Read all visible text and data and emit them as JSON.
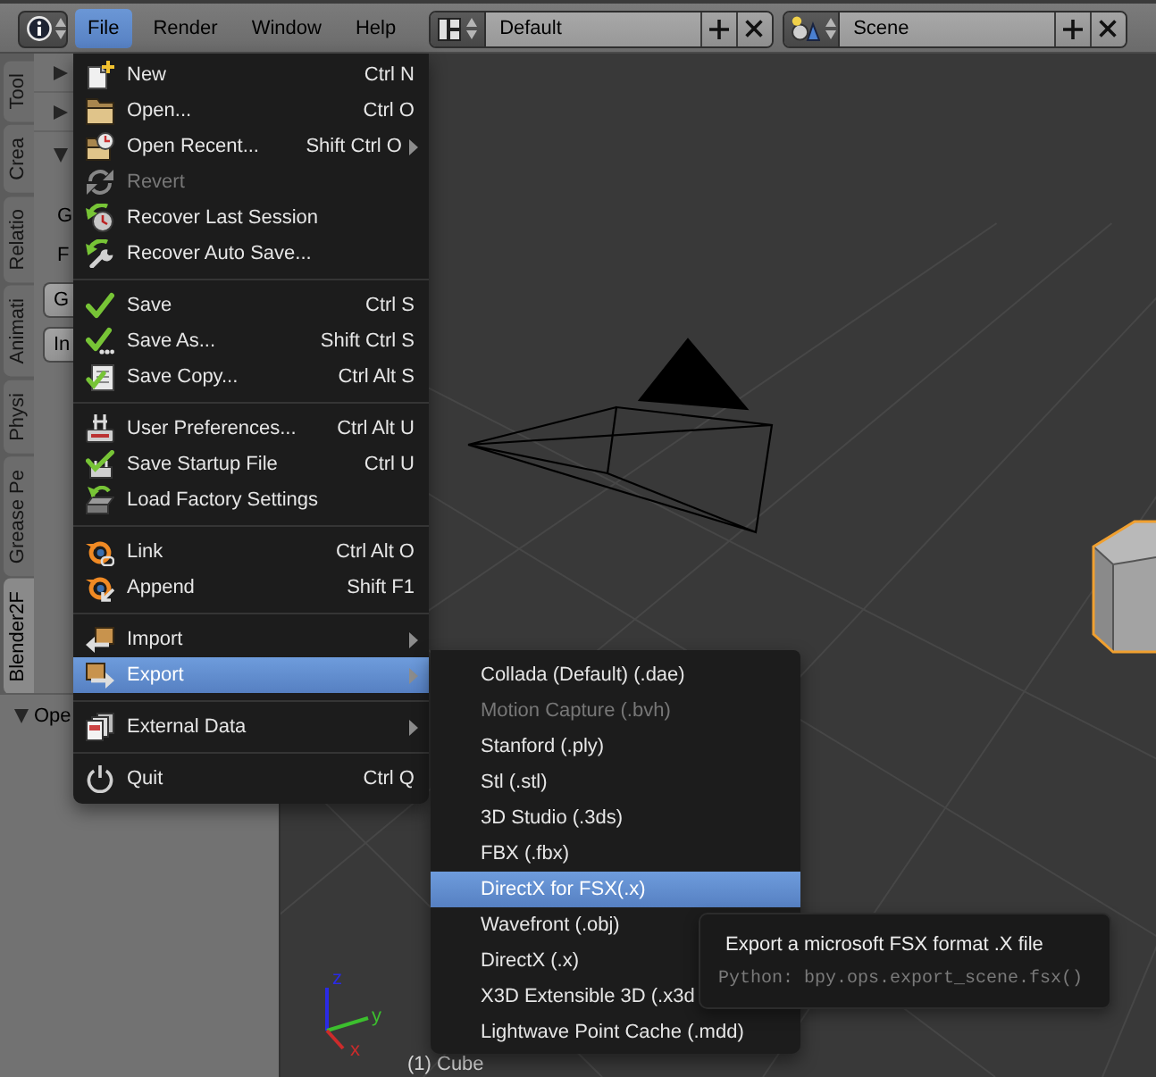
{
  "header": {
    "menus": [
      {
        "label": "File",
        "selected": true
      },
      {
        "label": "Render",
        "selected": false
      },
      {
        "label": "Window",
        "selected": false
      },
      {
        "label": "Help",
        "selected": false
      }
    ],
    "screen_layout": {
      "value": "Default"
    },
    "scene": {
      "value": "Scene"
    }
  },
  "tool_shelf": {
    "tabs": [
      {
        "label": "Tool",
        "selected": false
      },
      {
        "label": "Crea",
        "selected": false
      },
      {
        "label": "Relatio",
        "selected": false
      },
      {
        "label": "Animati",
        "selected": false
      },
      {
        "label": "Physi",
        "selected": false
      },
      {
        "label": "Grease Pe",
        "selected": false
      },
      {
        "label": "Blender2F",
        "selected": true
      }
    ],
    "panels": [
      {
        "expanded": false
      },
      {
        "expanded": false
      },
      {
        "expanded": true,
        "labels": [
          "G",
          "F"
        ],
        "buttons": [
          "G",
          "In"
        ]
      }
    ],
    "operator_panel": {
      "title": "Ope",
      "expanded": true
    }
  },
  "file_menu": {
    "items": [
      {
        "kind": "item",
        "label": "New",
        "shortcut": "Ctrl N",
        "disabled": false,
        "selected": false,
        "submenu": false
      },
      {
        "kind": "item",
        "label": "Open...",
        "shortcut": "Ctrl O",
        "disabled": false,
        "selected": false,
        "submenu": false
      },
      {
        "kind": "item",
        "label": "Open Recent...",
        "shortcut": "Shift Ctrl O",
        "disabled": false,
        "selected": false,
        "submenu": true
      },
      {
        "kind": "item",
        "label": "Revert",
        "disabled": true,
        "selected": false,
        "submenu": false
      },
      {
        "kind": "item",
        "label": "Recover Last Session",
        "disabled": false,
        "selected": false,
        "submenu": false
      },
      {
        "kind": "item",
        "label": "Recover Auto Save...",
        "disabled": false,
        "selected": false,
        "submenu": false
      },
      {
        "kind": "separator"
      },
      {
        "kind": "item",
        "label": "Save",
        "shortcut": "Ctrl S",
        "disabled": false,
        "selected": false,
        "submenu": false
      },
      {
        "kind": "item",
        "label": "Save As...",
        "shortcut": "Shift Ctrl S",
        "disabled": false,
        "selected": false,
        "submenu": false
      },
      {
        "kind": "item",
        "label": "Save Copy...",
        "shortcut": "Ctrl Alt S",
        "disabled": false,
        "selected": false,
        "submenu": false
      },
      {
        "kind": "separator"
      },
      {
        "kind": "item",
        "label": "User Preferences...",
        "shortcut": "Ctrl Alt U",
        "disabled": false,
        "selected": false,
        "submenu": false
      },
      {
        "kind": "item",
        "label": "Save Startup File",
        "shortcut": "Ctrl U",
        "disabled": false,
        "selected": false,
        "submenu": false
      },
      {
        "kind": "item",
        "label": "Load Factory Settings",
        "disabled": false,
        "selected": false,
        "submenu": false
      },
      {
        "kind": "separator"
      },
      {
        "kind": "item",
        "label": "Link",
        "shortcut": "Ctrl Alt O",
        "disabled": false,
        "selected": false,
        "submenu": false
      },
      {
        "kind": "item",
        "label": "Append",
        "shortcut": "Shift F1",
        "disabled": false,
        "selected": false,
        "submenu": false
      },
      {
        "kind": "separator"
      },
      {
        "kind": "item",
        "label": "Import",
        "disabled": false,
        "selected": false,
        "submenu": true
      },
      {
        "kind": "item",
        "label": "Export",
        "disabled": false,
        "selected": true,
        "submenu": true
      },
      {
        "kind": "separator"
      },
      {
        "kind": "item",
        "label": "External Data",
        "disabled": false,
        "selected": false,
        "submenu": true
      },
      {
        "kind": "separator"
      },
      {
        "kind": "item",
        "label": "Quit",
        "shortcut": "Ctrl Q",
        "disabled": false,
        "selected": false,
        "submenu": false
      }
    ]
  },
  "export_submenu": {
    "items": [
      {
        "label": "Collada (Default) (.dae)",
        "disabled": false,
        "selected": false
      },
      {
        "label": "Motion Capture (.bvh)",
        "disabled": true,
        "selected": false
      },
      {
        "label": "Stanford (.ply)",
        "disabled": false,
        "selected": false
      },
      {
        "label": "Stl (.stl)",
        "disabled": false,
        "selected": false
      },
      {
        "label": "3D Studio (.3ds)",
        "disabled": false,
        "selected": false
      },
      {
        "label": "FBX (.fbx)",
        "disabled": false,
        "selected": false
      },
      {
        "label": "DirectX for FSX(.x)",
        "disabled": false,
        "selected": true
      },
      {
        "label": "Wavefront (.obj)",
        "disabled": false,
        "selected": false
      },
      {
        "label": "DirectX (.x)",
        "disabled": false,
        "selected": false
      },
      {
        "label": "X3D Extensible 3D (.x3d",
        "disabled": false,
        "selected": false
      },
      {
        "label": "Lightwave Point Cache (.mdd)",
        "disabled": false,
        "selected": false
      }
    ]
  },
  "tooltip": {
    "text": "Export a microsoft FSX format .X file",
    "python": "Python: bpy.ops.export_scene.fsx()"
  },
  "viewport": {
    "axes": [
      {
        "label": "z",
        "color": "#2a2ae6"
      },
      {
        "label": "y",
        "color": "#3cbf2e"
      },
      {
        "label": "x",
        "color": "#cc2b2b"
      }
    ],
    "object_info": "(1) Cube"
  }
}
